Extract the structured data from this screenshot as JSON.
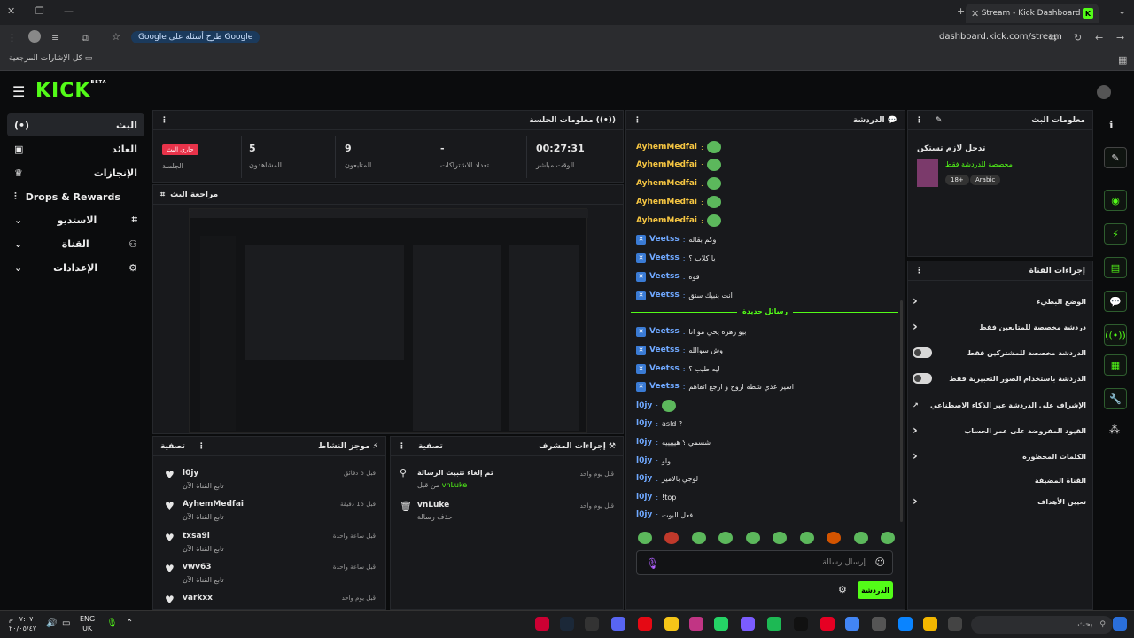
{
  "browser": {
    "tab_title": "Stream - Kick Dashboard",
    "url": "dashboard.kick.com/stream",
    "search_pill": "طرح أسئلة على Google",
    "bookmarks_label": "كل الإشارات المرجعية"
  },
  "app": {
    "logo": "KICK",
    "logo_badge": "BETA"
  },
  "sidebar": {
    "items": [
      {
        "label": "البث",
        "icon": "live-icon"
      },
      {
        "label": "العائد",
        "icon": "revenue-icon"
      },
      {
        "label": "الإنجازات",
        "icon": "trophy-icon"
      },
      {
        "label": "Drops & Rewards",
        "icon": "drops-icon"
      },
      {
        "label": "الاستديو",
        "icon": "studio-icon"
      },
      {
        "label": "القناة",
        "icon": "channel-icon"
      },
      {
        "label": "الإعدادات",
        "icon": "gear-icon"
      }
    ]
  },
  "session": {
    "title": "معلومات الجلسة",
    "live_badge": "جاري البث",
    "session_label": "الجلسة",
    "viewers_value": "5",
    "viewers_label": "المشاهدون",
    "followers_value": "9",
    "followers_label": "المتابعون",
    "subs_value": "-",
    "subs_label": "تعداد الاشتراكات",
    "time_value": "00:27:31",
    "time_label": "الوقت مباشر"
  },
  "preview": {
    "title": "مراجعة البث"
  },
  "activity": {
    "title": "موجز النشاط",
    "filter": "تصفية",
    "items": [
      {
        "user": "l0jy",
        "action": "تابع القناة الآن",
        "time": "قبل 5 دقائق"
      },
      {
        "user": "AyhemMedfai",
        "action": "تابع القناة الآن",
        "time": "قبل 15 دقيقة"
      },
      {
        "user": "txsa9l",
        "action": "تابع القناة الآن",
        "time": "قبل ساعة واحدة"
      },
      {
        "user": "vwv63",
        "action": "تابع القناة الآن",
        "time": "قبل ساعة واحدة"
      },
      {
        "user": "varkxx",
        "action": "",
        "time": "قبل يوم واحد"
      }
    ]
  },
  "modactions": {
    "title": "إجراءات المشرف",
    "filter": "تصفية",
    "items": [
      {
        "title": "تم إلغاء تثبيت الرسالة",
        "by_prefix": "من قبل",
        "by": "vnLuke",
        "time": "قبل يوم واحد"
      },
      {
        "title": "vnLuke",
        "by_prefix": "حذف رسالة",
        "by": "",
        "time": "قبل يوم واحد"
      }
    ]
  },
  "chat": {
    "title": "الدردشة",
    "new_messages": "رسائل جديدة",
    "input_placeholder": "إرسال رسالة",
    "send_label": "الدردشة",
    "messages": [
      {
        "user": "AyhemMedfai",
        "text": "",
        "color": "#f5c542",
        "emote": true
      },
      {
        "user": "AyhemMedfai",
        "text": "",
        "color": "#f5c542",
        "emote": true
      },
      {
        "user": "AyhemMedfai",
        "text": "",
        "color": "#f5c542",
        "emote": true
      },
      {
        "user": "AyhemMedfai",
        "text": "",
        "color": "#f5c542",
        "emote": true
      },
      {
        "user": "AyhemMedfai",
        "text": "",
        "color": "#f5c542",
        "emote": true
      },
      {
        "user": "Veetss",
        "text": "وكم بقاله",
        "color": "#6fa8ff",
        "emote": false
      },
      {
        "user": "Veetss",
        "text": "يا كلاب ؟",
        "color": "#6fa8ff",
        "emote": false
      },
      {
        "user": "Veetss",
        "text": "قوه",
        "color": "#6fa8ff",
        "emote": false
      },
      {
        "user": "Veetss",
        "text": "انت بنبيك سنق",
        "color": "#6fa8ff",
        "emote": false
      },
      {
        "user": "Veetss",
        "text": "بيو زهره يحي مو انا",
        "color": "#6fa8ff",
        "emote": false
      },
      {
        "user": "Veetss",
        "text": "وش سوالله",
        "color": "#6fa8ff",
        "emote": false
      },
      {
        "user": "Veetss",
        "text": "ليه طيب ؟",
        "color": "#6fa8ff",
        "emote": false
      },
      {
        "user": "Veetss",
        "text": "اسير عدي شطه اروح و ارجع اتفاهم",
        "color": "#6fa8ff",
        "emote": false
      },
      {
        "user": "l0jy",
        "text": "",
        "color": "#6fa8ff",
        "emote": true
      },
      {
        "user": "l0jy",
        "text": "asld ?",
        "color": "#6fa8ff",
        "emote": false
      },
      {
        "user": "l0jy",
        "text": "شسمي ؟ هيييييه",
        "color": "#6fa8ff",
        "emote": false
      },
      {
        "user": "l0jy",
        "text": "واو",
        "color": "#6fa8ff",
        "emote": false
      },
      {
        "user": "l0jy",
        "text": "لوجي بالامير",
        "color": "#6fa8ff",
        "emote": false
      },
      {
        "user": "l0jy",
        "text": "!top",
        "color": "#6fa8ff",
        "emote": false
      },
      {
        "user": "l0jy",
        "text": "فعل البوت",
        "color": "#6fa8ff",
        "emote": false
      }
    ]
  },
  "stream_info": {
    "title": "معلومات البث",
    "stream_title": "تدخل لازم تستكن",
    "category": "مخصصة للدردشة فقط",
    "tag_age": "18+",
    "tag_lang": "Arabic"
  },
  "channel_actions": {
    "title": "إجراءات القناة",
    "items": [
      {
        "label": "الوضع البطيء",
        "control": "chevron"
      },
      {
        "label": "دردشة مخصصة للمتابعين فقط",
        "control": "chevron"
      },
      {
        "label": "الدردشة مخصصة للمشتركين فقط",
        "control": "toggle"
      },
      {
        "label": "الدردشة باستخدام الصور التعبيرية فقط",
        "control": "toggle"
      },
      {
        "label": "الإشراف على الدردشة عبر الذكاء الاصطناعي",
        "control": "external"
      },
      {
        "label": "القيود المفروضة على عمر الحساب",
        "control": "chevron"
      },
      {
        "label": "الكلمات المحظورة",
        "control": "chevron"
      },
      {
        "label": "القناة المضيفة",
        "control": "none"
      },
      {
        "label": "تعيين الأهداف",
        "control": "chevron"
      }
    ]
  },
  "taskbar": {
    "time": "٠٧:٠٧ م",
    "date": "٢٠/٠٥/٤٧",
    "lang_top": "ENG",
    "lang_bottom": "UK",
    "search": "بحث"
  }
}
